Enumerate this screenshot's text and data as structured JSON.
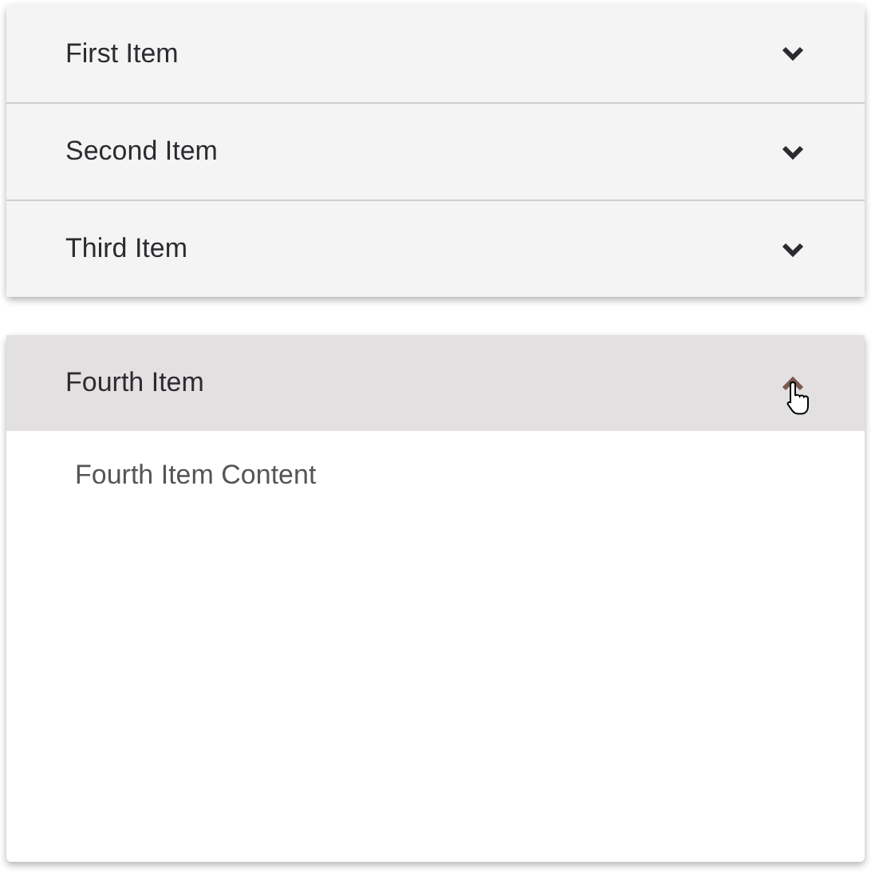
{
  "accordions": [
    {
      "items": [
        {
          "title": "First Item",
          "expanded": false
        },
        {
          "title": "Second Item",
          "expanded": false
        },
        {
          "title": "Third Item",
          "expanded": false
        }
      ]
    },
    {
      "items": [
        {
          "title": "Fourth Item",
          "expanded": true,
          "content": "Fourth Item Content"
        }
      ]
    }
  ]
}
